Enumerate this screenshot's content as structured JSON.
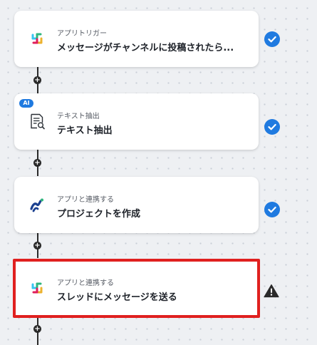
{
  "flow": {
    "steps": [
      {
        "subtitle": "アプリトリガー",
        "title": "メッセージがチャンネルに投稿されたら...",
        "icon": "slack-icon",
        "status": "complete"
      },
      {
        "subtitle": "テキスト抽出",
        "title": "テキスト抽出",
        "icon": "text-extract-icon",
        "badge": "AI",
        "status": "complete"
      },
      {
        "subtitle": "アプリと連携する",
        "title": "プロジェクトを作成",
        "icon": "backlog-app-icon",
        "status": "complete"
      },
      {
        "subtitle": "アプリと連携する",
        "title": "スレッドにメッセージを送る",
        "icon": "slack-icon",
        "status": "warning",
        "highlighted": true
      }
    ]
  },
  "colors": {
    "accent": "#1f7ae0",
    "highlight_border": "#e0201f",
    "connector": "#2a2a2a",
    "warning": "#2a2a2a"
  }
}
